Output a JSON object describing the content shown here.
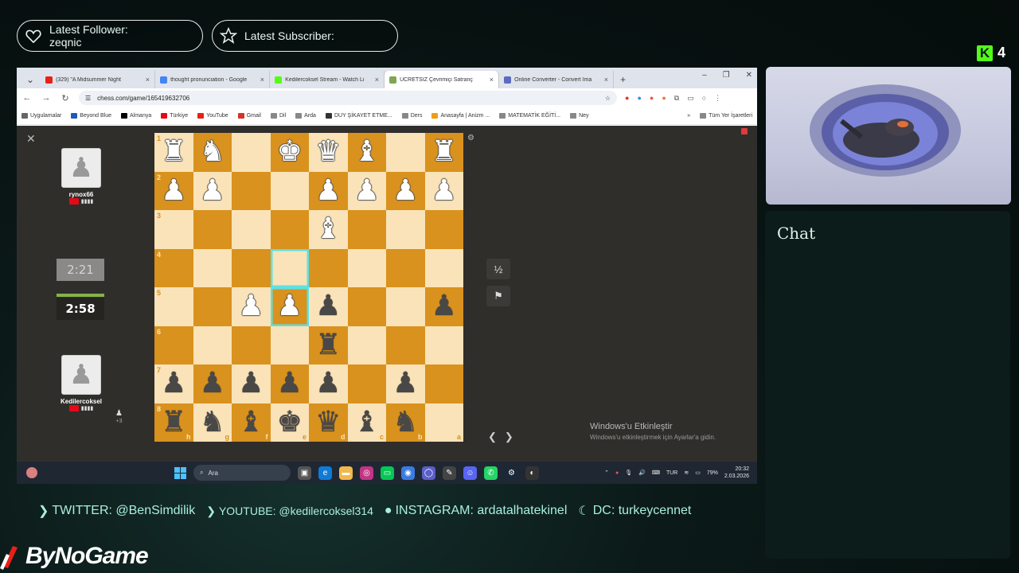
{
  "overlay": {
    "follower_title": "Latest Follower:",
    "follower_name": "zeqnic",
    "subscriber_title": "Latest Subscriber:",
    "subscriber_name": "",
    "kick_viewers": "4",
    "chat_title": "Chat"
  },
  "browser": {
    "tabs": [
      {
        "label": "(329) \"A Midsummer Night",
        "fav_color": "#e62117"
      },
      {
        "label": "thought pronunciation - Google",
        "fav_color": "#4285f4"
      },
      {
        "label": "Kedilercoksel Stream - Watch Li",
        "fav_color": "#53fc18"
      },
      {
        "label": "ÜCRETSİZ Çevrimiçi Satranç",
        "fav_color": "#7fa650"
      },
      {
        "label": "Online Converter - Convert Ima",
        "fav_color": "#5c6bc0"
      }
    ],
    "url": "chess.com/game/165419632706",
    "bookmarks": [
      {
        "label": "Uygulamalar",
        "color": "#666"
      },
      {
        "label": "Beyond Blue",
        "color": "#1e5bb8"
      },
      {
        "label": "Almanya",
        "color": "#000"
      },
      {
        "label": "Türkiye",
        "color": "#e30a17"
      },
      {
        "label": "YouTube",
        "color": "#e62117"
      },
      {
        "label": "Gmail",
        "color": "#d93025"
      },
      {
        "label": "Dil",
        "color": "#888"
      },
      {
        "label": "Arda",
        "color": "#888"
      },
      {
        "label": "DUY ŞİKAYET ETME...",
        "color": "#333"
      },
      {
        "label": "Ders",
        "color": "#888"
      },
      {
        "label": "Anasayfa | Anizm ...",
        "color": "#f39c12"
      },
      {
        "label": "MATEMATİK EĞİTİ...",
        "color": "#888"
      },
      {
        "label": "Ney",
        "color": "#888"
      }
    ],
    "bookmarks_right": "Tüm Yer İşaretleri"
  },
  "game": {
    "top_player": "rynox66",
    "bottom_player": "Kedilercoksel",
    "top_clock": "2:21",
    "bottom_clock": "2:58",
    "extra_count": "+3",
    "draw_icon": "½",
    "ranks": [
      "1",
      "2",
      "3",
      "4",
      "5",
      "6",
      "7",
      "8"
    ],
    "files": [
      "h",
      "g",
      "f",
      "e",
      "d",
      "c",
      "b",
      "a"
    ],
    "board": [
      [
        "wR",
        "wN",
        "",
        "wK",
        "wQ",
        "wB",
        "",
        "wR"
      ],
      [
        "wP",
        "wP",
        "",
        "",
        "wP",
        "wP",
        "wP",
        "wP"
      ],
      [
        "",
        "",
        "",
        "",
        "wB",
        "",
        "",
        ""
      ],
      [
        "",
        "",
        "",
        "",
        "",
        "",
        "",
        ""
      ],
      [
        "",
        "",
        "wP",
        "wP",
        "bP",
        "",
        "",
        "bP"
      ],
      [
        "",
        "",
        "",
        "",
        "bR",
        "",
        "",
        ""
      ],
      [
        "bP",
        "bP",
        "bP",
        "bP",
        "bP",
        "",
        "bP",
        ""
      ],
      [
        "bR",
        "bN",
        "bB",
        "bK",
        "bQ",
        "bB",
        "bN",
        ""
      ]
    ],
    "highlight": [
      [
        3,
        3
      ],
      [
        4,
        3
      ]
    ],
    "activation_title": "Windows'u Etkinleştir",
    "activation_sub": "Windows'u etkinleştirmek için Ayarlar'a gidin."
  },
  "taskbar": {
    "search_label": "Ara",
    "language": "TUR",
    "battery": "79%",
    "time": "20:32",
    "date": "2.03.2026"
  },
  "socials": {
    "twitter": "TWITTER: @BenSimdilik",
    "youtube": "YOUTUBE: @kedilercoksel314",
    "instagram": "INSTAGRAM: ardatalhatekinel",
    "discord": "DC: turkeycennet"
  },
  "sponsor": "ByNoGame",
  "colors": {
    "board_light": "#fae3b8",
    "board_dark": "#d9921d",
    "highlight": "#5ce1e6",
    "accent_text": "#a9efe0",
    "kick_green": "#53fc18"
  }
}
